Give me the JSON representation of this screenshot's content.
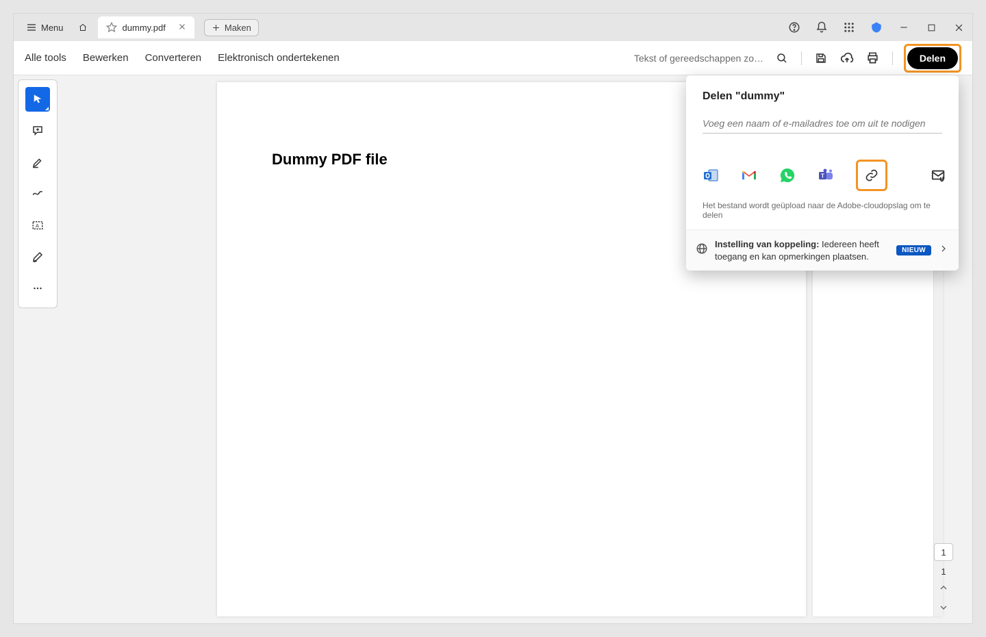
{
  "titlebar": {
    "menu_label": "Menu",
    "tab_filename": "dummy.pdf",
    "new_label": "Maken"
  },
  "toolbar": {
    "all_tools": "Alle tools",
    "edit": "Bewerken",
    "convert": "Converteren",
    "esign": "Elektronisch ondertekenen",
    "search_placeholder": "Tekst of gereedschappen zoe…",
    "share_label": "Delen"
  },
  "document": {
    "heading": "Dummy PDF file"
  },
  "share_panel": {
    "title": "Delen \"dummy\"",
    "invite_placeholder": "Voeg een naam of e-mailadres toe om uit te nodigen",
    "upload_note": "Het bestand wordt geüpload naar de Adobe-cloudopslag om te delen",
    "link_settings_label": "Instelling van koppeling:",
    "link_settings_desc": "Iedereen heeft toegang en kan opmerkingen plaatsen.",
    "badge": "NIEUW"
  },
  "page_nav": {
    "input": "1",
    "total": "1"
  }
}
